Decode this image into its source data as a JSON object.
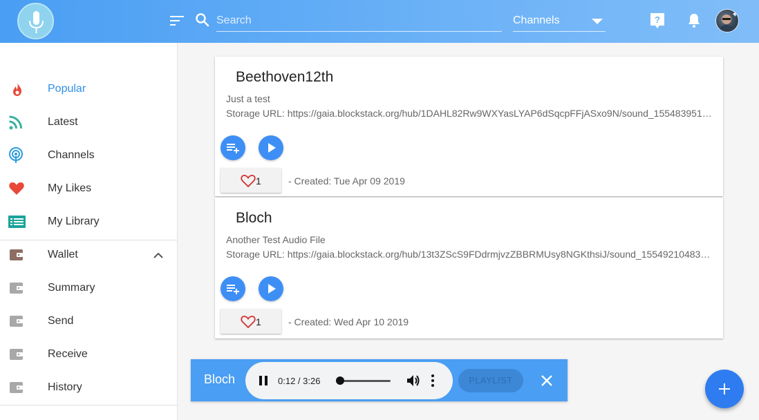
{
  "header": {
    "search_placeholder": "Search",
    "channels_label": "Channels"
  },
  "sidebar": {
    "items": [
      {
        "label": "Popular",
        "icon": "fire-icon",
        "active": true
      },
      {
        "label": "Latest",
        "icon": "rss-feed-icon"
      },
      {
        "label": "Channels",
        "icon": "podcast-icon"
      },
      {
        "label": "My Likes",
        "icon": "heart-icon"
      },
      {
        "label": "My Library",
        "icon": "library-list-icon"
      },
      {
        "label": "Wallet",
        "icon": "wallet-icon"
      },
      {
        "label": "Summary",
        "icon": "wallet-icon"
      },
      {
        "label": "Send",
        "icon": "wallet-icon"
      },
      {
        "label": "Receive",
        "icon": "wallet-icon"
      },
      {
        "label": "History",
        "icon": "wallet-icon"
      }
    ]
  },
  "cards": [
    {
      "title": "Beethoven12th",
      "description": "Just a test",
      "url": "Storage URL: https://gaia.blockstack.org/hub/1DAHL82Rw9WXYasLYAP6dSqcpFFjASxo9N/sound_1554839519…",
      "likes": "1",
      "created": "- Created: Tue Apr 09 2019"
    },
    {
      "title": "Bloch",
      "description": "Another Test Audio File",
      "url": "Storage URL: https://gaia.blockstack.org/hub/13t3ZScS9FDdrmjvzZBBRMUsy8NGKthsiJ/sound_15549210483…",
      "likes": "1",
      "created": "- Created: Wed Apr 10 2019"
    }
  ],
  "player": {
    "title": "Bloch",
    "time": "0:12 / 3:26",
    "progress_fraction": 0.058,
    "playlist_label": "PLAYLIST"
  },
  "colors": {
    "accent": "#4a9ef3",
    "active_nav": "#2f8ee5",
    "fab": "#2f7cf0"
  }
}
